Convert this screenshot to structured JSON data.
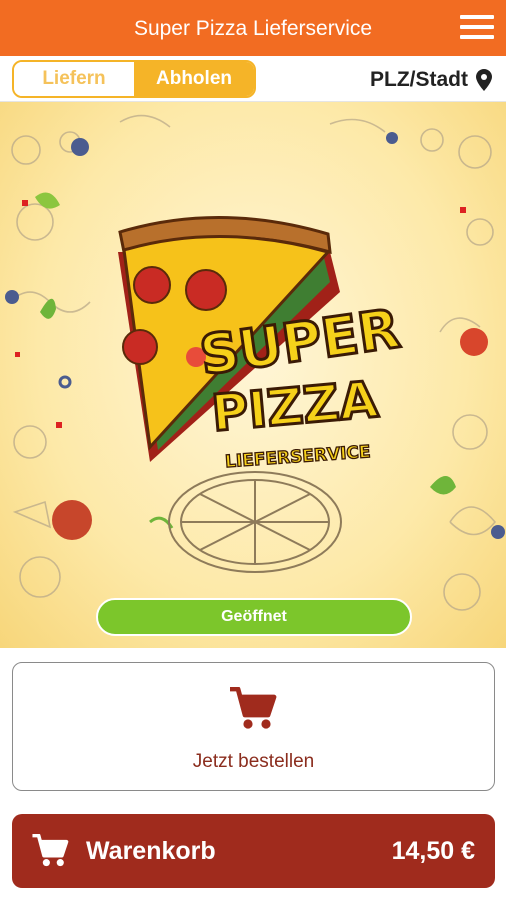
{
  "header": {
    "title": "Super Pizza Lieferservice",
    "menu_icon": "hamburger-menu-icon"
  },
  "mode_toggle": {
    "options": [
      "Liefern",
      "Abholen"
    ],
    "selected": "Abholen"
  },
  "location": {
    "label": "PLZ/Stadt",
    "icon": "location-pin-icon"
  },
  "hero": {
    "logo_lines": [
      "SUPER",
      "PIZZA",
      "LIEFERSERVICE"
    ],
    "logo_text": "Super Pizza Lieferservice"
  },
  "status": {
    "label": "Geöffnet"
  },
  "order": {
    "label": "Jetzt bestellen",
    "icon": "shopping-cart-icon"
  },
  "cart": {
    "label": "Warenkorb",
    "total": "14,50 €",
    "icon": "shopping-cart-icon"
  },
  "colors": {
    "header_orange": "#f26c22",
    "toggle_yellow": "#f5b428",
    "status_green": "#7cc62b",
    "cart_red": "#a02b1d",
    "order_text": "#8b2d1e"
  }
}
